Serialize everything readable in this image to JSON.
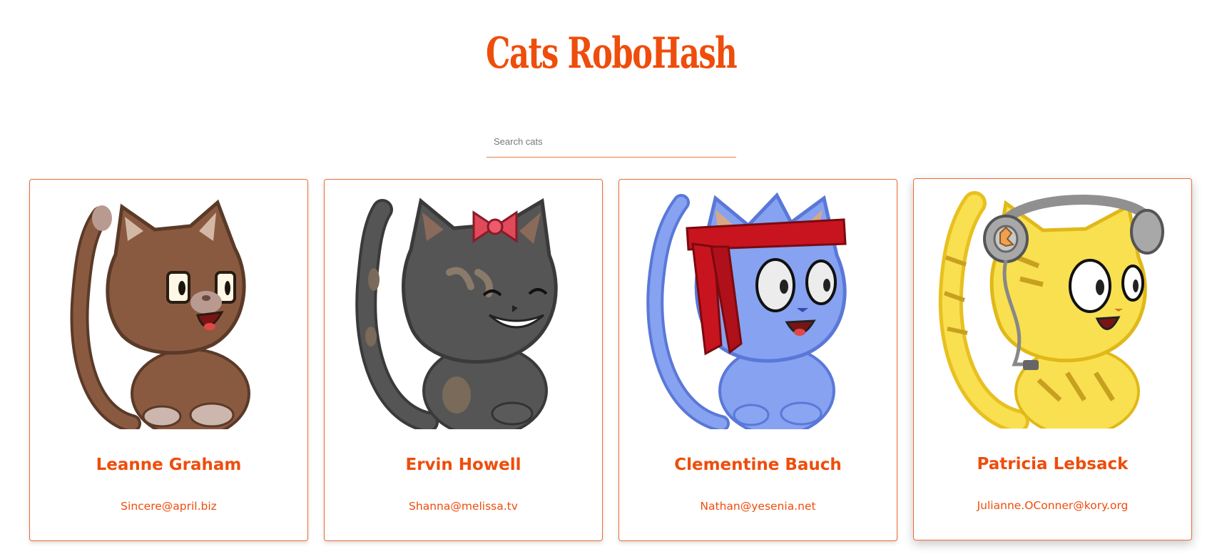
{
  "app": {
    "title": "Cats RoboHash"
  },
  "search": {
    "placeholder": "Search cats",
    "value": ""
  },
  "colors": {
    "accent": "#ee4d0c",
    "card_border": "#f06a33"
  },
  "cards": [
    {
      "name": "Leanne Graham",
      "email": "Sincere@april.biz",
      "avatar_icon": "brown-cat-avatar"
    },
    {
      "name": "Ervin Howell",
      "email": "Shanna@melissa.tv",
      "avatar_icon": "gray-cat-with-bow-avatar"
    },
    {
      "name": "Clementine Bauch",
      "email": "Nathan@yesenia.net",
      "avatar_icon": "blue-cat-with-headband-avatar"
    },
    {
      "name": "Patricia Lebsack",
      "email": "Julianne.OConner@kory.org",
      "avatar_icon": "yellow-cat-with-headphones-avatar"
    }
  ]
}
